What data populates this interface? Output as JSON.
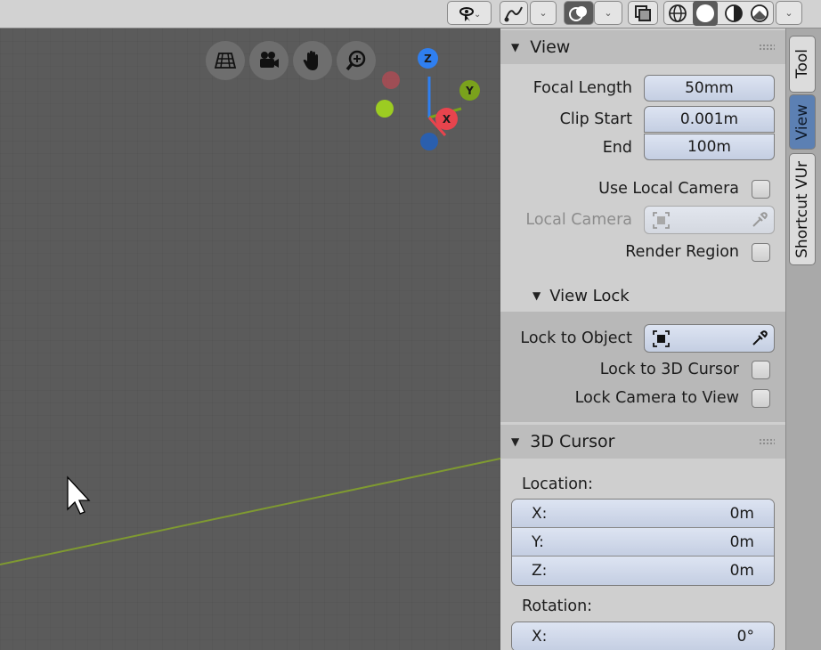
{
  "header": {
    "buttons": [
      {
        "icon": "select-cursor-icon"
      },
      {
        "icon": "gizmo-icon"
      },
      {
        "icon": "overlay-icon"
      },
      {
        "icon": "xray-toggle-icon"
      },
      {
        "icon": "wireframe-shading-icon"
      },
      {
        "icon": "solid-shading-icon"
      },
      {
        "icon": "material-shading-icon"
      },
      {
        "icon": "rendered-shading-icon"
      }
    ]
  },
  "viewport": {
    "nav_buttons": [
      "grid-view-icon",
      "camera-view-icon",
      "pan-hand-icon",
      "zoom-icon"
    ],
    "gizmo": {
      "z": "Z",
      "y": "Y",
      "x": "X"
    },
    "colors": {
      "x": "#e8444d",
      "y": "#7aa21c",
      "z": "#2f7ff0",
      "ground_line": "#7f9a31"
    }
  },
  "sidebar": {
    "view_panel": {
      "title": "View",
      "focal_length_label": "Focal Length",
      "focal_length_value": "50mm",
      "clip_start_label": "Clip Start",
      "clip_start_value": "0.001m",
      "clip_end_label": "End",
      "clip_end_value": "100m",
      "use_local_camera_label": "Use Local Camera",
      "local_camera_label": "Local Camera",
      "render_region_label": "Render Region"
    },
    "view_lock": {
      "title": "View Lock",
      "lock_to_object_label": "Lock to Object",
      "lock_to_3d_cursor_label": "Lock to 3D Cursor",
      "lock_camera_to_view_label": "Lock Camera to View"
    },
    "cursor_panel": {
      "title": "3D Cursor",
      "location_label": "Location:",
      "location": [
        {
          "axis": "X:",
          "value": "0m"
        },
        {
          "axis": "Y:",
          "value": "0m"
        },
        {
          "axis": "Z:",
          "value": "0m"
        }
      ],
      "rotation_label": "Rotation:",
      "rotation": [
        {
          "axis": "X:",
          "value": "0°"
        }
      ]
    }
  },
  "tabs": [
    {
      "label": "Tool",
      "active": false
    },
    {
      "label": "View",
      "active": true
    },
    {
      "label": "Shortcut VUr",
      "active": false
    }
  ]
}
